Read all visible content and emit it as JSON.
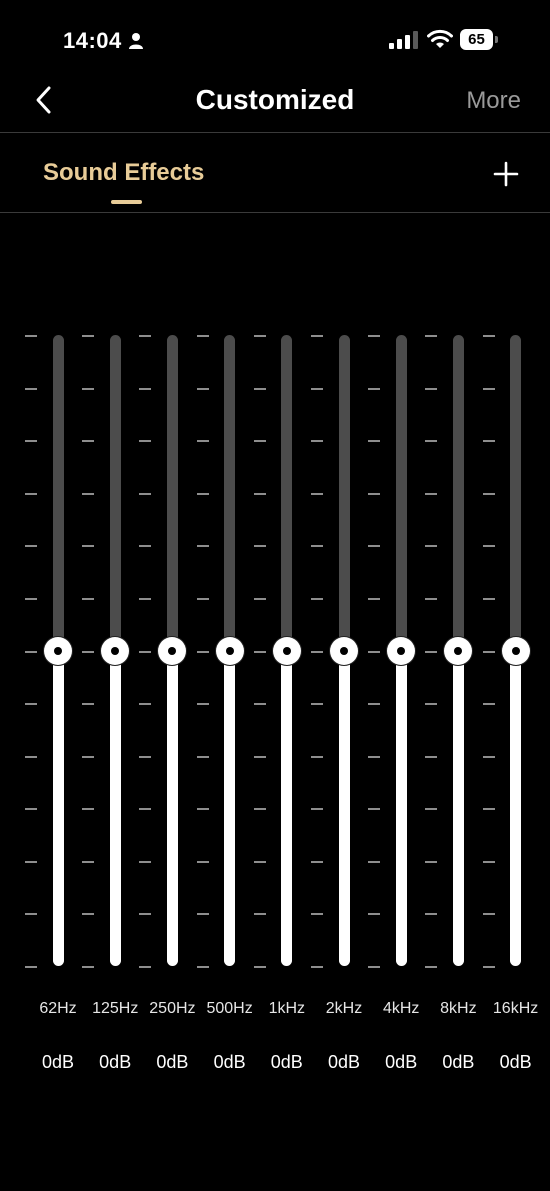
{
  "status_bar": {
    "time": "14:04",
    "battery": "65",
    "icons": [
      "person-icon",
      "signal-icon",
      "wifi-icon",
      "battery-icon"
    ]
  },
  "nav": {
    "back_icon": "chevron-left-icon",
    "title": "Customized",
    "more_label": "More"
  },
  "tabs": {
    "active": "Sound Effects",
    "add_icon": "plus-icon",
    "accent_color": "#e8cc98"
  },
  "equalizer": {
    "scale_ticks": 13,
    "bands": [
      {
        "freq": "62Hz",
        "gain": "0dB",
        "level": 0.5
      },
      {
        "freq": "125Hz",
        "gain": "0dB",
        "level": 0.5
      },
      {
        "freq": "250Hz",
        "gain": "0dB",
        "level": 0.5
      },
      {
        "freq": "500Hz",
        "gain": "0dB",
        "level": 0.5
      },
      {
        "freq": "1kHz",
        "gain": "0dB",
        "level": 0.5
      },
      {
        "freq": "2kHz",
        "gain": "0dB",
        "level": 0.5
      },
      {
        "freq": "4kHz",
        "gain": "0dB",
        "level": 0.5
      },
      {
        "freq": "8kHz",
        "gain": "0dB",
        "level": 0.5
      },
      {
        "freq": "16kHz",
        "gain": "0dB",
        "level": 0.5
      }
    ]
  }
}
